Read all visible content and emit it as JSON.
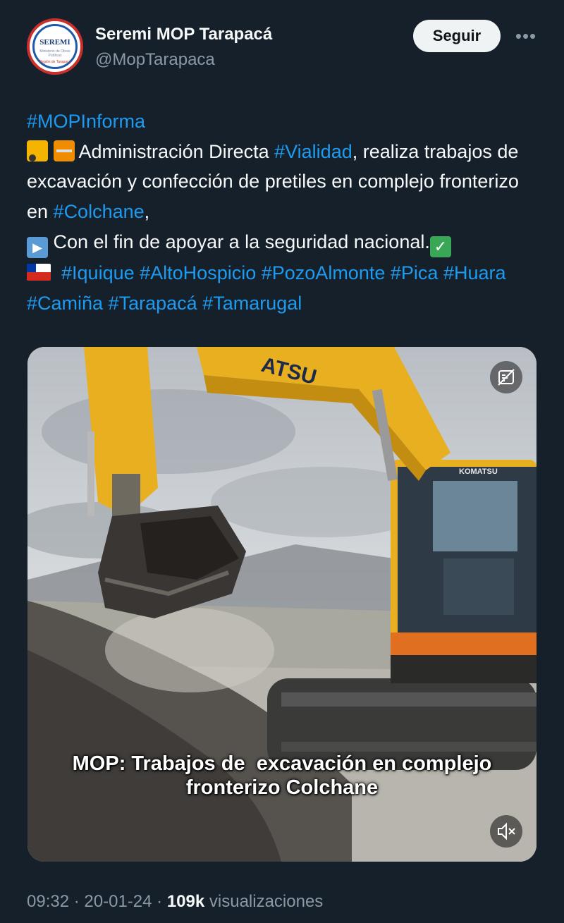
{
  "account": {
    "name": "Seremi MOP Tarapacá",
    "handle": "@MopTarapaca",
    "avatar_logo_text": "SEREMI",
    "avatar_logo_subtext": "Ministerio de Obras Públicas",
    "avatar_logo_region": "Región de Tarapacá"
  },
  "actions": {
    "follow_label": "Seguir",
    "more_icon": "more-horizontal-icon"
  },
  "tweet": {
    "line1_tag": "#MOPInforma",
    "line2_text_a": " Administración Directa ",
    "line2_tag": "#Vialidad",
    "line2_text_b": ", realiza trabajos de excavación y confección de pretiles en complejo fronterizo en ",
    "line2_tag2": "#Colchane",
    "line2_text_c": ",",
    "line3_text": " Con el fin de apoyar a la seguridad nacional.",
    "hashtags": [
      "#Iquique",
      "#AltoHospicio",
      "#PozoAlmonte",
      "#Pica",
      "#Huara",
      "#Camiña",
      "#Tarapacá",
      "#Tamarugal"
    ],
    "emojis": [
      "tractor-emoji",
      "safety-vest-emoji",
      "play-button-emoji",
      "check-mark-emoji",
      "chile-flag-emoji"
    ]
  },
  "media": {
    "caption_line1": "MOP: Trabajos de  excavación en complejo",
    "caption_line2": "fronterizo Colchane",
    "machine_brand": "KOMATSU",
    "arm_brand": "ATSU",
    "gif_icon": "gif-icon",
    "mute_icon": "mute-icon"
  },
  "meta": {
    "time": "09:32",
    "date": "20-01-24",
    "views_count": "109k",
    "views_label": "visualizaciones",
    "separator": "·"
  },
  "colors": {
    "background": "#15202b",
    "link": "#1d9bf0",
    "secondary_text": "#8b98a5",
    "excavator_yellow": "#e8b020"
  }
}
